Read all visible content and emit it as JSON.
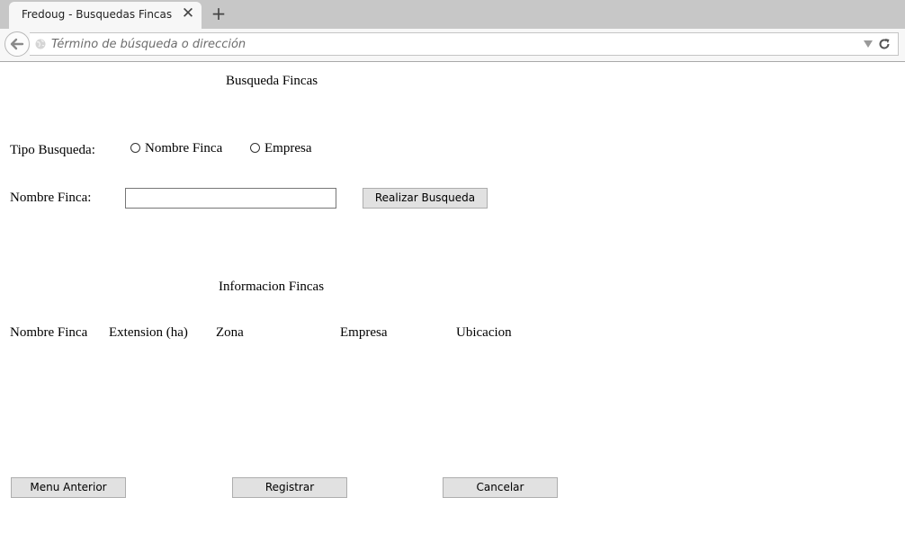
{
  "browser": {
    "tab_title": "Fredoug - Busquedas Fincas",
    "url_placeholder": "Término de búsqueda o dirección",
    "icons": [
      "close-icon",
      "plus-icon",
      "back-arrow-icon",
      "globe-icon",
      "dropdown-arrow-icon",
      "reload-icon"
    ]
  },
  "search": {
    "title": "Busqueda Fincas",
    "type_label": "Tipo Busqueda:",
    "options": [
      {
        "label": "Nombre Finca",
        "checked": false
      },
      {
        "label": "Empresa",
        "checked": false
      }
    ],
    "name_label": "Nombre Finca:",
    "name_value": "",
    "submit_label": "Realizar Busqueda"
  },
  "results": {
    "title": "Informacion Fincas",
    "columns": [
      "Nombre Finca",
      "Extension (ha)",
      "Zona",
      "Empresa",
      "Ubicacion"
    ]
  },
  "footer": {
    "back_label": "Menu Anterior",
    "register_label": "Registrar",
    "cancel_label": "Cancelar"
  }
}
